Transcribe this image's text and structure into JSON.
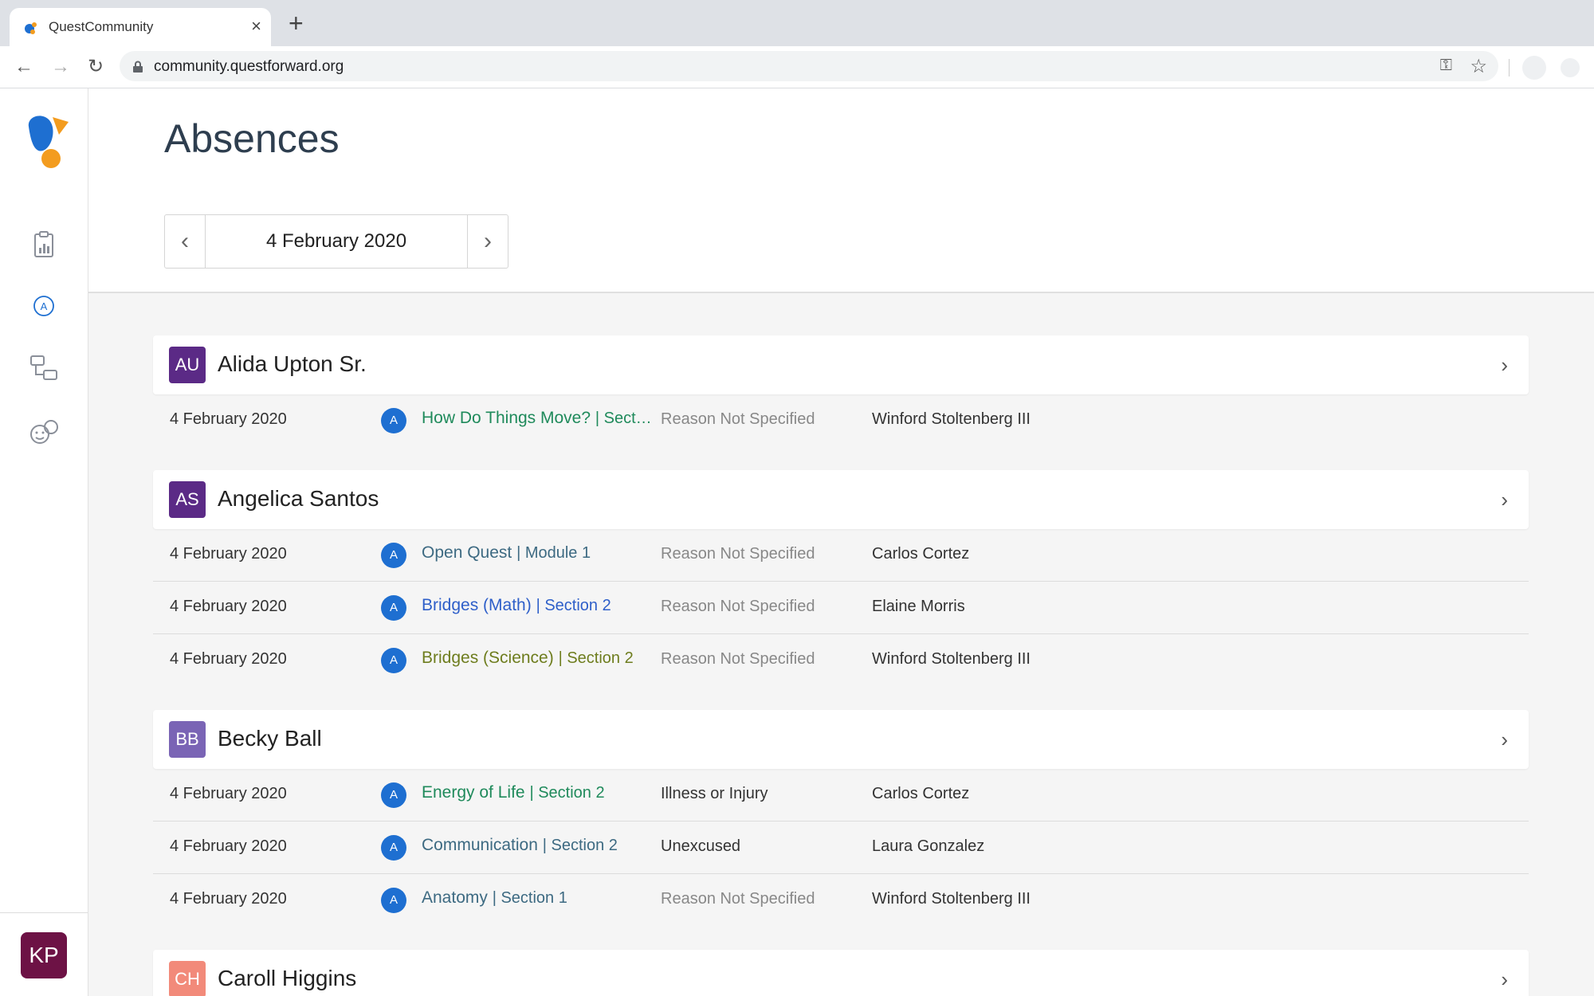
{
  "browser": {
    "tab_title": "QuestCommunity",
    "tab_close": "×",
    "new_tab": "+",
    "url": "community.questforward.org"
  },
  "sidebar": {
    "icons": [
      "reports-clipboard-icon",
      "attendance-a-icon",
      "groups-icon",
      "students-faces-icon"
    ],
    "user_initials": "KP"
  },
  "header": {
    "title": "Absences"
  },
  "date_nav": {
    "current": "4 February 2020",
    "prev": "‹",
    "next": "›"
  },
  "students": [
    {
      "name": "Alida Upton Sr.",
      "initials": "AU",
      "color": "#5b2a86",
      "absences": [
        {
          "date": "4 February 2020",
          "badge": "A",
          "course": "How Do Things Move?",
          "section": "| Sect…",
          "course_color": "#1f8a5b",
          "reason": "Reason Not Specified",
          "reason_color": "#888888",
          "teacher": "Winford Stoltenberg III"
        }
      ]
    },
    {
      "name": "Angelica Santos",
      "initials": "AS",
      "color": "#5b2a86",
      "absences": [
        {
          "date": "4 February 2020",
          "badge": "A",
          "course": "Open Quest",
          "section": "| Module 1",
          "course_color": "#3d6a82",
          "reason": "Reason Not Specified",
          "reason_color": "#888888",
          "teacher": "Carlos Cortez"
        },
        {
          "date": "4 February 2020",
          "badge": "A",
          "course": "Bridges (Math)",
          "section": "| Section 2",
          "course_color": "#2e5fc9",
          "reason": "Reason Not Specified",
          "reason_color": "#888888",
          "teacher": "Elaine Morris"
        },
        {
          "date": "4 February 2020",
          "badge": "A",
          "course": "Bridges (Science)",
          "section": "| Section 2",
          "course_color": "#6e7d1e",
          "reason": "Reason Not Specified",
          "reason_color": "#888888",
          "teacher": "Winford Stoltenberg III"
        }
      ]
    },
    {
      "name": "Becky Ball",
      "initials": "BB",
      "color": "#7a64b5",
      "absences": [
        {
          "date": "4 February 2020",
          "badge": "A",
          "course": "Energy of Life",
          "section": "| Section 2",
          "course_color": "#1f8a5b",
          "reason": "Illness or Injury",
          "reason_color": "#333333",
          "teacher": "Carlos Cortez"
        },
        {
          "date": "4 February 2020",
          "badge": "A",
          "course": "Communication",
          "section": "| Section 2",
          "course_color": "#3d6a82",
          "reason": "Unexcused",
          "reason_color": "#333333",
          "teacher": "Laura Gonzalez"
        },
        {
          "date": "4 February 2020",
          "badge": "A",
          "course": "Anatomy",
          "section": "| Section 1",
          "course_color": "#3d6a82",
          "reason": "Reason Not Specified",
          "reason_color": "#888888",
          "teacher": "Winford Stoltenberg III"
        }
      ]
    },
    {
      "name": "Caroll Higgins",
      "initials": "CH",
      "color": "#f28a7a",
      "absences": []
    }
  ]
}
